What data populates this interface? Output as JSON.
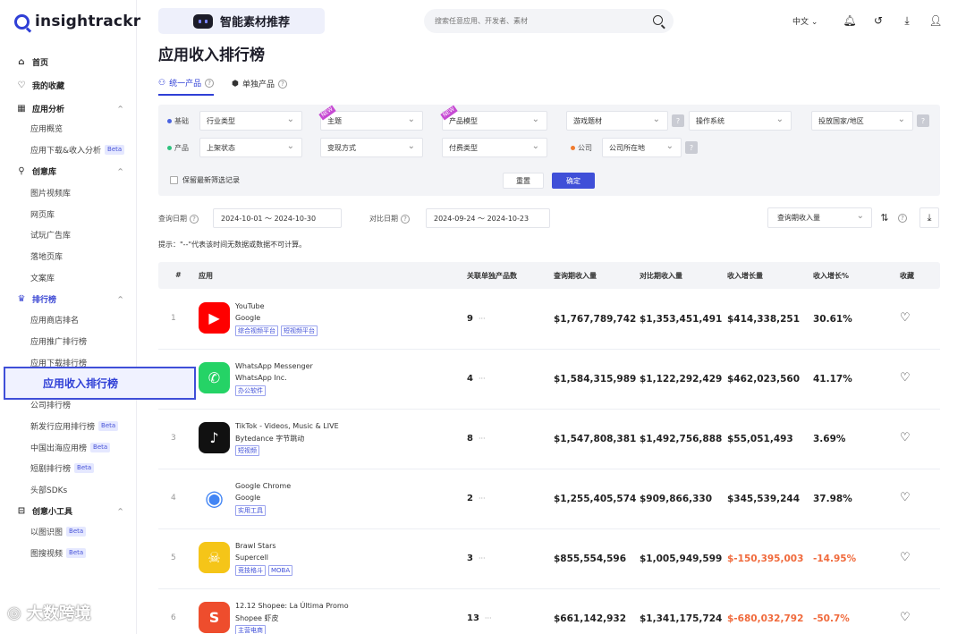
{
  "brand": {
    "name": "insightrackr"
  },
  "sidebar": {
    "items": [
      {
        "label": "首页",
        "kind": "top",
        "icon": "home-icon"
      },
      {
        "label": "我的收藏",
        "kind": "top",
        "icon": "heart-icon"
      },
      {
        "label": "应用分析",
        "kind": "top",
        "icon": "grid-icon"
      },
      {
        "label": "应用概览",
        "kind": "sub"
      },
      {
        "label": "应用下载&收入分析",
        "kind": "sub",
        "beta": "Beta"
      },
      {
        "label": "创意库",
        "kind": "top",
        "icon": "bulb-icon"
      },
      {
        "label": "图片视频库",
        "kind": "sub"
      },
      {
        "label": "网页库",
        "kind": "sub"
      },
      {
        "label": "试玩广告库",
        "kind": "sub"
      },
      {
        "label": "落地页库",
        "kind": "sub"
      },
      {
        "label": "文案库",
        "kind": "sub"
      },
      {
        "label": "排行榜",
        "kind": "top",
        "icon": "trophy-icon"
      },
      {
        "label": "应用商店排名",
        "kind": "sub"
      },
      {
        "label": "应用推广排行榜",
        "kind": "sub"
      },
      {
        "label": "应用下载排行榜",
        "kind": "sub"
      },
      {
        "label": "应用收入排行榜",
        "kind": "sub"
      },
      {
        "label": "公司排行榜",
        "kind": "sub"
      },
      {
        "label": "新发行应用排行榜",
        "kind": "sub",
        "beta": "Beta"
      },
      {
        "label": "中国出海应用榜",
        "kind": "sub",
        "beta": "Beta"
      },
      {
        "label": "短剧排行榜",
        "kind": "sub",
        "beta": "Beta"
      },
      {
        "label": "头部SDKs",
        "kind": "sub"
      },
      {
        "label": "创意小工具",
        "kind": "top",
        "icon": "toolbox-icon"
      },
      {
        "label": "以图识图",
        "kind": "sub",
        "beta": "Beta"
      },
      {
        "label": "图搜视频",
        "kind": "sub",
        "beta": "Beta"
      }
    ],
    "active_label": "应用收入排行榜"
  },
  "topbar": {
    "promo_label": "智能素材推荐",
    "search_placeholder": "搜索任意应用、开发者、素材",
    "lang": "中文"
  },
  "page": {
    "title": "应用收入排行榜",
    "tabs": [
      {
        "label": "统一产品"
      },
      {
        "label": "单独产品"
      }
    ]
  },
  "filters": {
    "group1_label": "基础",
    "group2_label": "产品",
    "group3_label": "公司",
    "industry": "行业类型",
    "theme": "主题",
    "product_model": "产品模型",
    "game_theme": "游戏题材",
    "os": "操作系统",
    "region": "投放国家/地区",
    "status": "上架状态",
    "monetization": "变现方式",
    "pay_type": "付费类型",
    "company_location": "公司所在地",
    "keep_label": "保留最新筛选记录",
    "reset": "重置",
    "ok": "确定",
    "tag_new": "NEW"
  },
  "dates": {
    "query_label": "查询日期",
    "query_range": "2024-10-01 ～ 2024-10-30",
    "compare_label": "对比日期",
    "compare_range": "2024-09-24 ～ 2024-10-23",
    "sort_label": "查询期收入量"
  },
  "hint": "提示：\"--\"代表该时间无数据或数据不可计算。",
  "table": {
    "headers": [
      "#",
      "应用",
      "关联单独产品数",
      "查询期收入量",
      "对比期收入量",
      "收入增长量",
      "收入增长%",
      "收藏"
    ],
    "rows": [
      {
        "rank": "1",
        "name": "YouTube",
        "dev": "Google",
        "tags": [
          "综合视频平台",
          "短视频平台"
        ],
        "count": "9",
        "query": "$1,767,789,742",
        "compare": "$1,353,451,491",
        "growth": "$414,338,251",
        "pct": "30.61%",
        "neg": false,
        "icon_bg": "#ff0000",
        "icon_glyph": "▶"
      },
      {
        "rank": "2",
        "name": "WhatsApp Messenger",
        "dev": "WhatsApp Inc.",
        "tags": [
          "办公软件"
        ],
        "count": "4",
        "query": "$1,584,315,989",
        "compare": "$1,122,292,429",
        "growth": "$462,023,560",
        "pct": "41.17%",
        "neg": false,
        "icon_bg": "#25d366",
        "icon_glyph": "✆"
      },
      {
        "rank": "3",
        "name": "TikTok - Videos, Music & LIVE",
        "dev": "Bytedance 字节跳动",
        "tags": [
          "短视频"
        ],
        "count": "8",
        "query": "$1,547,808,381",
        "compare": "$1,492,756,888",
        "growth": "$55,051,493",
        "pct": "3.69%",
        "neg": false,
        "icon_bg": "#111111",
        "icon_glyph": "♪"
      },
      {
        "rank": "4",
        "name": "Google Chrome",
        "dev": "Google",
        "tags": [
          "实用工具"
        ],
        "count": "2",
        "query": "$1,255,405,574",
        "compare": "$909,866,330",
        "growth": "$345,539,244",
        "pct": "37.98%",
        "neg": false,
        "icon_bg": "#ffffff",
        "icon_glyph": "◉"
      },
      {
        "rank": "5",
        "name": "Brawl Stars",
        "dev": "Supercell",
        "tags": [
          "竞技格斗",
          "MOBA"
        ],
        "count": "3",
        "query": "$855,554,596",
        "compare": "$1,005,949,599",
        "growth": "$-150,395,003",
        "pct": "-14.95%",
        "neg": true,
        "icon_bg": "#f5c518",
        "icon_glyph": "☠"
      },
      {
        "rank": "6",
        "name": "12.12 Shopee: La Última Promo",
        "dev": "Shopee 虾皮",
        "tags": [
          "主营电商"
        ],
        "count": "13",
        "query": "$661,142,932",
        "compare": "$1,341,175,724",
        "growth": "$-680,032,792",
        "pct": "-50.7%",
        "neg": true,
        "icon_bg": "#ee4d2d",
        "icon_glyph": "S"
      }
    ]
  },
  "watermark": "大数跨境",
  "colors": {
    "accent": "#3f4fd8",
    "negative": "#f06a3c",
    "panel": "#f3f4f7"
  }
}
